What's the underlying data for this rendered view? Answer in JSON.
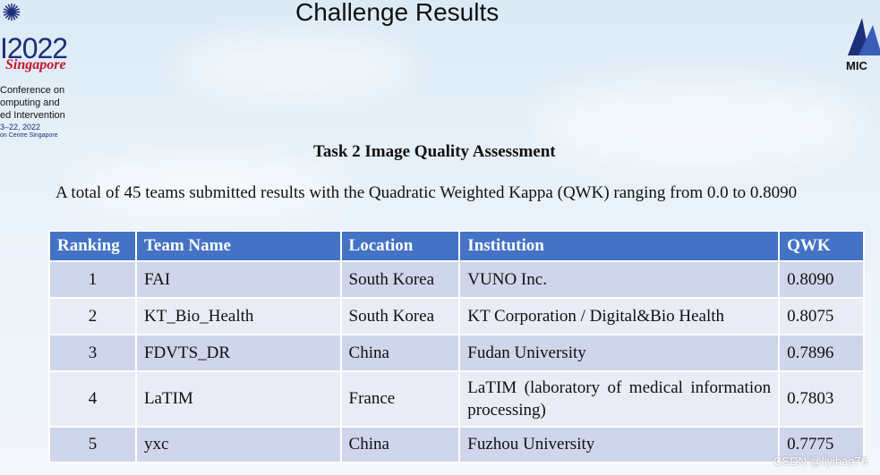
{
  "header": {
    "title": "Challenge Results",
    "logo_left": {
      "year": "I2022",
      "city": "Singapore",
      "lines": [
        "Conference on",
        "omputing and",
        "ed Intervention",
        "3–22, 2022",
        "on Centre Singapore"
      ]
    },
    "logo_right": {
      "text": "MIC"
    }
  },
  "section": {
    "subtitle": "Task 2 Image Quality Assessment",
    "summary": "A total of 45 teams submitted results with the Quadratic Weighted Kappa (QWK) ranging from 0.0 to 0.8090"
  },
  "table": {
    "columns": [
      "Ranking",
      "Team Name",
      "Location",
      "Institution",
      "QWK"
    ],
    "rows": [
      {
        "ranking": "1",
        "team": "FAI",
        "location": "South Korea",
        "institution": "VUNO Inc.",
        "qwk": "0.8090"
      },
      {
        "ranking": "2",
        "team": "KT_Bio_Health",
        "location": "South Korea",
        "institution": "KT Corporation / Digital&Bio Health",
        "qwk": "0.8075"
      },
      {
        "ranking": "3",
        "team": "FDVTS_DR",
        "location": "China",
        "institution": "Fudan University",
        "qwk": "0.7896"
      },
      {
        "ranking": "4",
        "team": "LaTIM",
        "location": "France",
        "institution": "LaTIM (laboratory of medical information processing)",
        "qwk": "0.7803"
      },
      {
        "ranking": "5",
        "team": "yxc",
        "location": "China",
        "institution": "Fuzhou University",
        "qwk": "0.7775"
      }
    ]
  },
  "watermark": "CSDN @liyihao76",
  "colors": {
    "header_fill": "#4472c4",
    "row_odd": "#cfd5ea",
    "row_even": "#e9ebf5"
  }
}
